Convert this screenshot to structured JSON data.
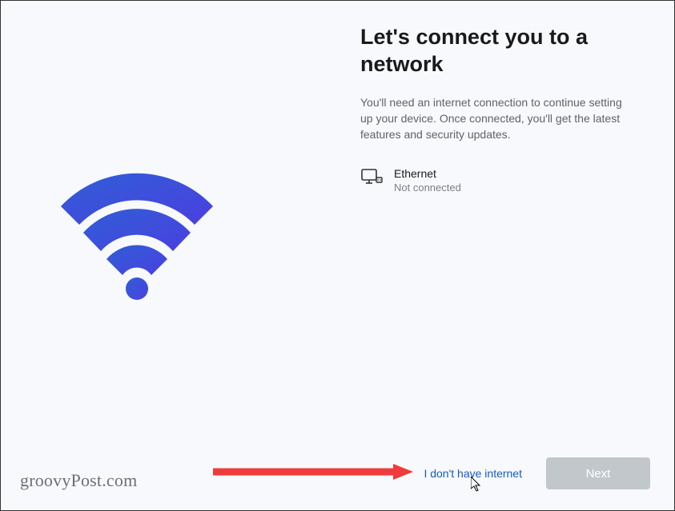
{
  "title": "Let's connect you to a network",
  "subtitle": "You'll need an internet connection to continue setting up your device. Once connected, you'll get the latest features and security updates.",
  "network": {
    "label": "Ethernet",
    "status": "Not connected"
  },
  "actions": {
    "no_internet": "I don't have internet",
    "next": "Next"
  },
  "watermark": "groovyPost.com"
}
